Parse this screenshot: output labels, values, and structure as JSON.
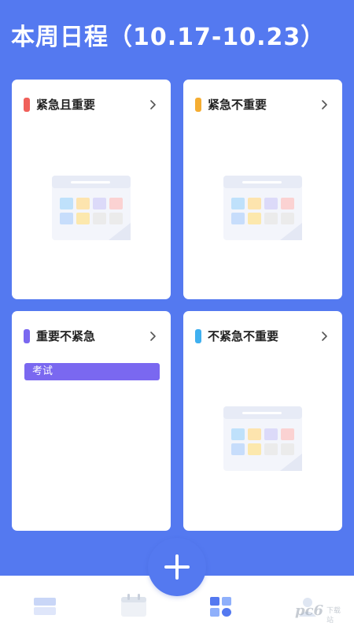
{
  "header": {
    "title": "本周日程（10.17-10.23）"
  },
  "quadrants": [
    {
      "title": "紧急且重要",
      "marker_color": "#f0605a",
      "empty": true
    },
    {
      "title": "紧急不重要",
      "marker_color": "#f5ad32",
      "empty": true
    },
    {
      "title": "重要不紧急",
      "marker_color": "#7a68f0",
      "empty": false,
      "tasks": [
        "考试"
      ]
    },
    {
      "title": "不紧急不重要",
      "marker_color": "#3fb0f0",
      "empty": true
    }
  ],
  "icons": {
    "arrow": "chevron-right-icon",
    "add": "plus-icon",
    "tabs": [
      "list-tab-icon",
      "calendar-tab-icon",
      "quadrant-tab-icon",
      "profile-tab-icon"
    ]
  },
  "colors": {
    "primary": "#5479f0",
    "card_bg": "#ffffff",
    "task_bg": "#7a68f0"
  },
  "watermark": {
    "text": "pc6",
    "sub": "下载站"
  }
}
